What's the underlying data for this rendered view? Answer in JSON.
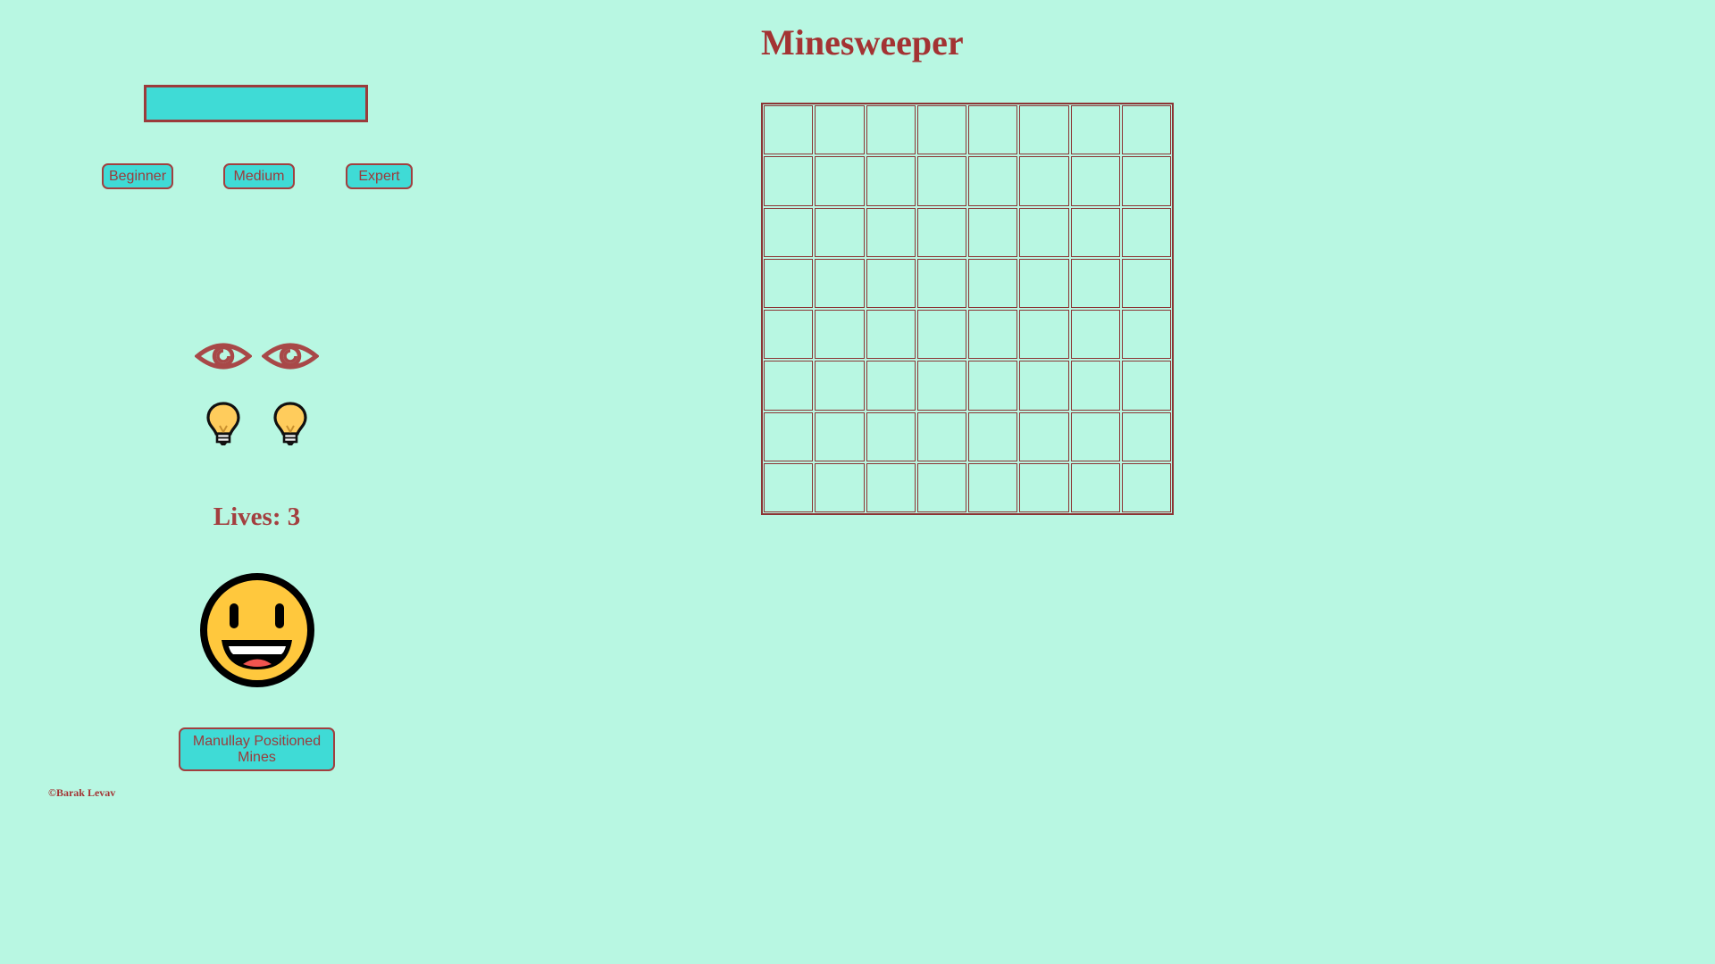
{
  "title": "Minesweeper",
  "levels": [
    {
      "label": "Beginner"
    },
    {
      "label": "Medium"
    },
    {
      "label": "Expert"
    }
  ],
  "safe_clicks": {
    "icon": "eye-icon",
    "count": 2
  },
  "hints": {
    "icon": "lightbulb-icon",
    "count": 2
  },
  "lives_text": "Lives: 3",
  "smiley": {
    "icon": "smiley-face-icon",
    "state": "happy"
  },
  "manual_button_label": "Manullay Positioned Mines",
  "copyright": "©Barak Levav",
  "board": {
    "rows": 8,
    "cols": 8
  },
  "colors": {
    "background": "#b8f7e2",
    "accent": "#3fdbd6",
    "border": "#9b3b3b",
    "text": "#a33333"
  }
}
